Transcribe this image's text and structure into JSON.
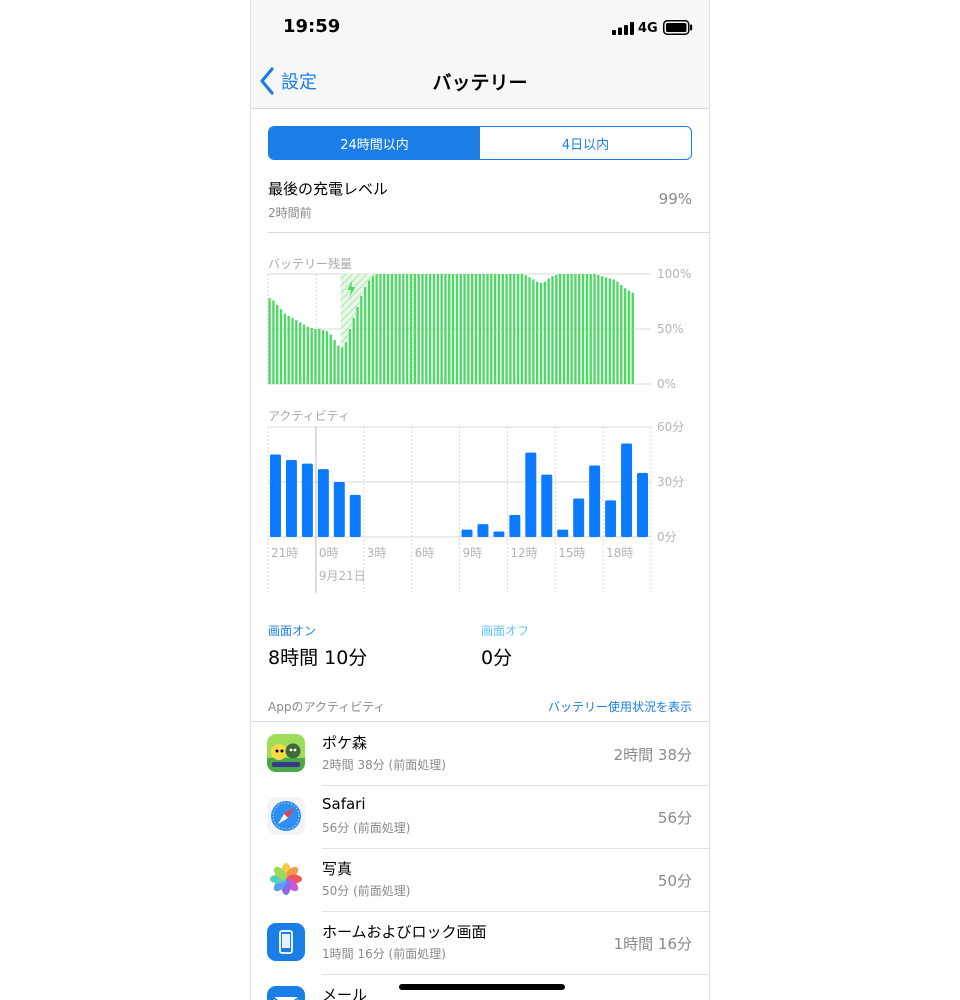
{
  "status": {
    "time": "19:59",
    "network": "4G"
  },
  "nav": {
    "back_label": "設定",
    "title": "バッテリー"
  },
  "segments": [
    {
      "label": "24時間以内",
      "active": true
    },
    {
      "label": "4日以内",
      "active": false
    }
  ],
  "last_charge": {
    "title": "最後の充電レベル",
    "subtitle": "2時間前",
    "value": "99%"
  },
  "colors": {
    "accent": "#1a7ee6",
    "battery_green": "#4cd964",
    "activity_blue": "#0a7aff"
  },
  "battery_chart": {
    "label": "バッテリー残量",
    "y_ticks": [
      "100%",
      "50%",
      "0%"
    ]
  },
  "activity_chart": {
    "label": "アクティビティ",
    "y_ticks": [
      "60分",
      "30分",
      "0分"
    ],
    "x_ticks": [
      "21時",
      "0時",
      "3時",
      "6時",
      "9時",
      "12時",
      "15時",
      "18時"
    ],
    "date_label": "9月21日"
  },
  "chart_data": [
    {
      "type": "bar",
      "title": "バッテリー残量",
      "ylim": [
        0,
        100
      ],
      "y_ticks": [
        "0%",
        "50%",
        "100%"
      ],
      "values": [
        78,
        76,
        72,
        68,
        64,
        62,
        60,
        58,
        56,
        54,
        52,
        51,
        50,
        50,
        49,
        48,
        45,
        40,
        35,
        33,
        38,
        50,
        60,
        70,
        80,
        88,
        94,
        98,
        100,
        100,
        100,
        100,
        100,
        100,
        100,
        100,
        100,
        100,
        100,
        100,
        100,
        100,
        100,
        100,
        100,
        100,
        100,
        100,
        100,
        100,
        100,
        100,
        100,
        100,
        100,
        100,
        100,
        100,
        100,
        100,
        100,
        100,
        100,
        100,
        100,
        100,
        100,
        99,
        97,
        95,
        93,
        92,
        93,
        96,
        98,
        99,
        100,
        100,
        100,
        100,
        100,
        100,
        100,
        100,
        100,
        100,
        99,
        98,
        97,
        96,
        95,
        93,
        90,
        87,
        85,
        83
      ],
      "charging_range": [
        19,
        30
      ]
    },
    {
      "type": "bar",
      "title": "アクティビティ",
      "ylabel": "分",
      "ylim": [
        0,
        60
      ],
      "y_ticks": [
        "0分",
        "30分",
        "60分"
      ],
      "x": [
        "21時",
        "0時",
        "3時",
        "6時",
        "9時",
        "12時",
        "15時",
        "18時"
      ],
      "values": [
        45,
        42,
        40,
        37,
        30,
        23,
        0,
        0,
        0,
        0,
        0,
        0,
        4,
        7,
        3,
        12,
        46,
        34,
        4,
        21,
        39,
        20,
        51,
        35
      ]
    }
  ],
  "screen": {
    "on_label": "画面オン",
    "on_value": "8時間 10分",
    "off_label": "画面オフ",
    "off_value": "0分"
  },
  "app_activity": {
    "title": "Appのアクティビティ",
    "link": "バッテリー使用状況を表示",
    "apps": [
      {
        "name": "ポケ森",
        "sub": "2時間 38分 (前面処理)",
        "duration": "2時間 38分",
        "icon": "pokemori-icon"
      },
      {
        "name": "Safari",
        "sub": "56分 (前面処理)",
        "duration": "56分",
        "icon": "safari-icon"
      },
      {
        "name": "写真",
        "sub": "50分 (前面処理)",
        "duration": "50分",
        "icon": "photos-icon"
      },
      {
        "name": "ホームおよびロック画面",
        "sub": "1時間 16分 (前面処理)",
        "duration": "1時間 16分",
        "icon": "home-lock-icon"
      },
      {
        "name": "メール",
        "sub": "",
        "duration": "",
        "icon": "mail-icon"
      }
    ]
  }
}
